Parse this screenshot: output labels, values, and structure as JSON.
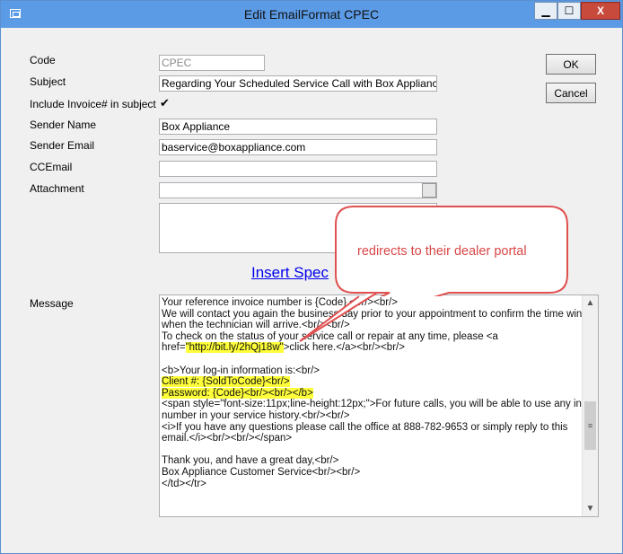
{
  "window": {
    "title": "Edit EmailFormat CPEC",
    "minimize_glyph": "▁",
    "maximize_glyph": "☐",
    "close_glyph": "X"
  },
  "form": {
    "code_label": "Code",
    "code_value": "CPEC",
    "subject_label": "Subject",
    "subject_value": "Regarding Your Scheduled Service Call with Box Appliance",
    "include_invoice_label": "Include Invoice# in subject",
    "include_invoice_checked": "✔",
    "sender_name_label": "Sender Name",
    "sender_name_value": "Box Appliance",
    "sender_email_label": "Sender Email",
    "sender_email_value": "baservice@boxappliance.com",
    "ccemail_label": "CCEmail",
    "ccemail_value": "",
    "attachment_label": "Attachment",
    "attachment_value": "",
    "insert_link": "Insert Spec",
    "message_label": "Message"
  },
  "buttons": {
    "ok": "OK",
    "cancel": "Cancel"
  },
  "message_lines": [
    {
      "text": "Your reference invoice number is {Code}.<br/><br/>",
      "highlight": ""
    },
    {
      "text": "We will contact you again the business day prior to your appointment to confirm the time window",
      "highlight": ""
    },
    {
      "text": "when the technician will arrive.<br/><br/>",
      "highlight": ""
    },
    {
      "text": "To check on the status of your service call or repair at any time, please <a",
      "highlight": ""
    },
    {
      "text": "href=\"http://bit.ly/2hQj18w\">click here.</a><br/><br/>",
      "highlight": "\"http://bit.ly/2hQj18w\""
    },
    {
      "text": "",
      "highlight": ""
    },
    {
      "text": "<b>Your log-in information is:<br/>",
      "highlight": ""
    },
    {
      "text": "Client #:  {SoldToCode}<br/>",
      "highlight": "Client #:  {SoldToCode}<br/>"
    },
    {
      "text": "Password:  {Code}<br/><br/></b>",
      "highlight": "Password:  {Code}<br/><br/></b>"
    },
    {
      "text": "<span style=\"font-size:11px;line-height:12px;\">For future calls, you will be able to use any invoice",
      "highlight": ""
    },
    {
      "text": "number in your service history.<br/><br/>",
      "highlight": ""
    },
    {
      "text": "<i>If you have any questions please call the office at 888-782-9653 or simply reply to this",
      "highlight": ""
    },
    {
      "text": "email.</i><br/><br/></span>",
      "highlight": ""
    },
    {
      "text": "",
      "highlight": ""
    },
    {
      "text": "Thank you, and have a great day,<br/>",
      "highlight": ""
    },
    {
      "text": "Box Appliance Customer Service<br/><br/>",
      "highlight": ""
    },
    {
      "text": "</td></tr>",
      "highlight": ""
    }
  ],
  "scroll": {
    "up_glyph": "▲",
    "down_glyph": "▼",
    "thumb_glyph": "≡"
  },
  "callout": {
    "text": "redirects to their dealer portal",
    "fill": "#ffffff",
    "stroke": "#e05050"
  }
}
